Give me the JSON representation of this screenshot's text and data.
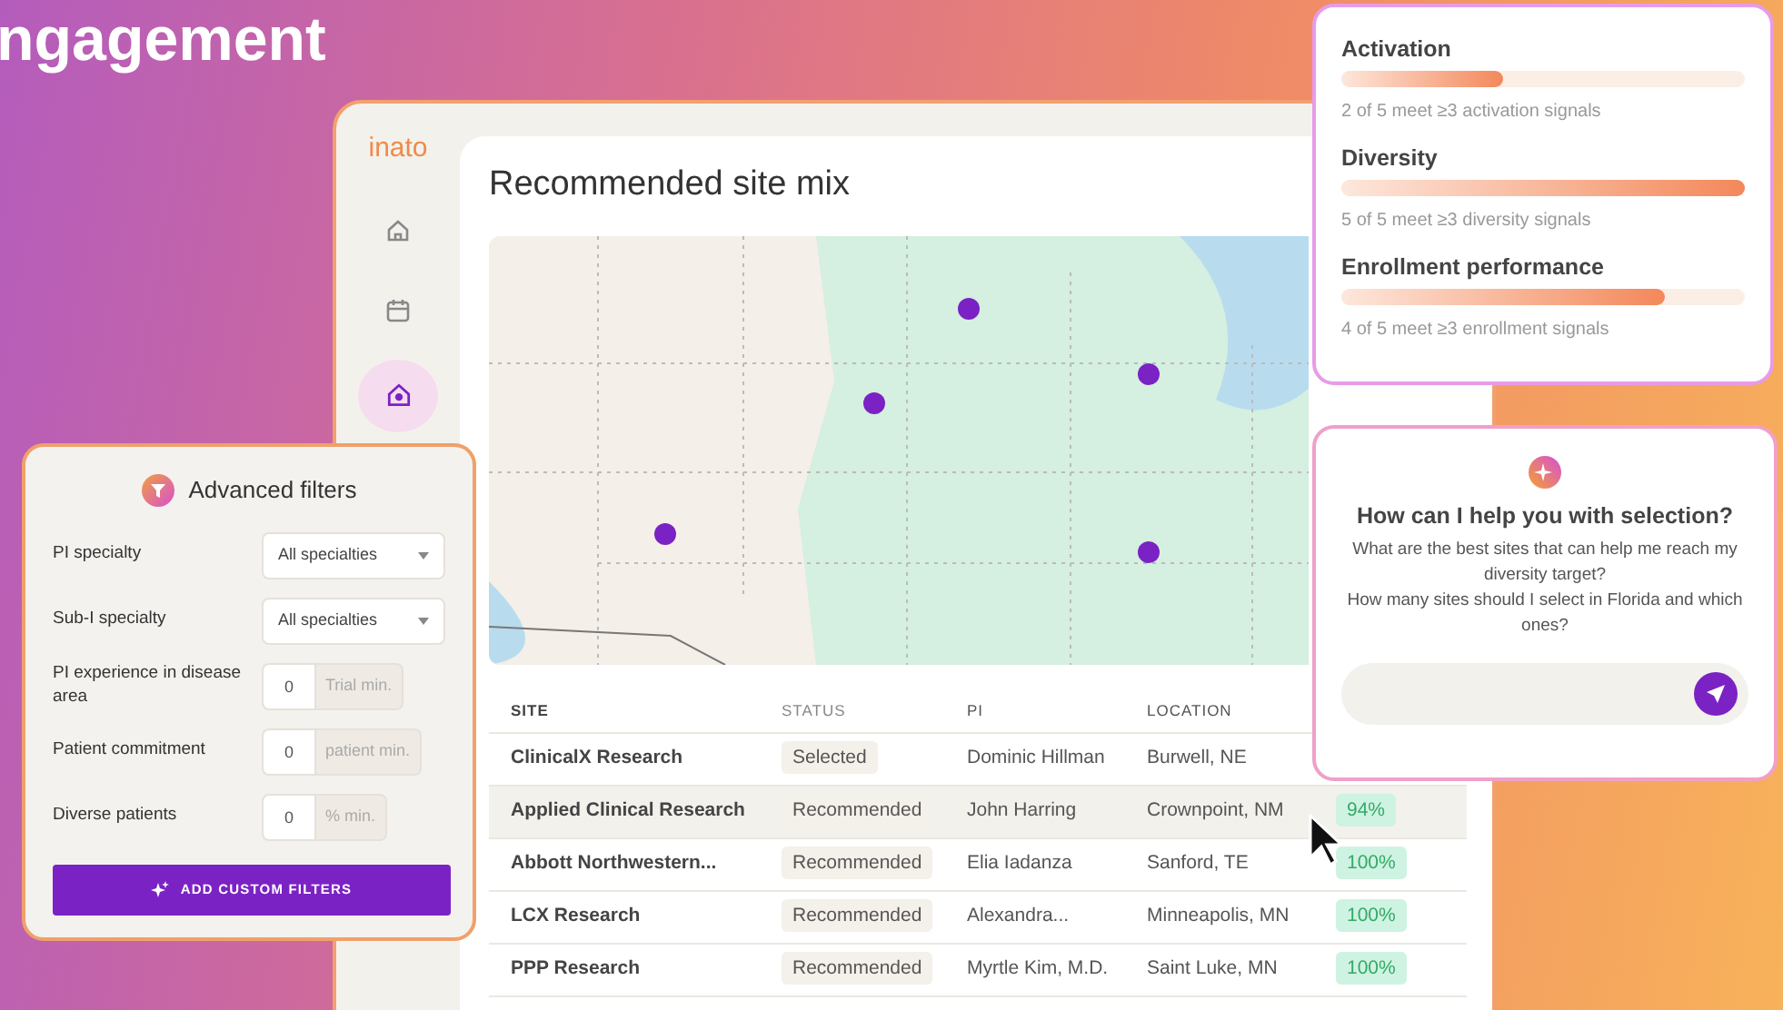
{
  "headline": "ngagement",
  "app": {
    "logo": "inato",
    "sidebar": [
      {
        "kind": "home",
        "selected": false
      },
      {
        "kind": "calendar",
        "selected": false
      },
      {
        "kind": "site",
        "selected": true
      }
    ],
    "title": "Recommended site mix",
    "table": {
      "columns": [
        "SITE",
        "STATUS",
        "PI",
        "LOCATION"
      ],
      "rows": [
        {
          "site": "ClinicalX Research",
          "status": "Selected",
          "pi": "Dominic Hillman",
          "location": "Burwell, NE",
          "selected": false
        },
        {
          "site": "Applied Clinical Research",
          "status": "Recommended",
          "pi": "John Harring",
          "location": "Crownpoint, NM",
          "column_5": "94%",
          "selected": true
        },
        {
          "site": "Abbott Northwestern...",
          "status": "Recommended",
          "pi": "Elia Iadanza",
          "location": "Sanford, TE",
          "column_5": "100%",
          "selected": false
        },
        {
          "site": "LCX Research",
          "status": "Recommended",
          "pi": "Alexandra...",
          "location": "Minneapolis, MN",
          "column_5": "100%",
          "selected": false
        },
        {
          "site": "PPP Research",
          "status": "Recommended",
          "pi": "Myrtle Kim, M.D.",
          "location": "Saint Luke, MN",
          "column_5": "100%",
          "selected": false
        }
      ]
    }
  },
  "filters": {
    "title": "Advanced filters",
    "items": [
      {
        "kind": "select",
        "label": "PI specialty",
        "value": "All specialties"
      },
      {
        "kind": "select",
        "label": "Sub-I specialty",
        "value": "All specialties"
      },
      {
        "kind": "number",
        "label": "PI experience in disease area",
        "value": "0",
        "unit": "Trial min."
      },
      {
        "kind": "number",
        "label": "Patient commitment",
        "value": "0",
        "unit": "patient min."
      },
      {
        "kind": "number",
        "label": "Diverse patients",
        "value": "0",
        "unit": "% min."
      }
    ],
    "button": "ADD CUSTOM FILTERS"
  },
  "signals": [
    {
      "title": "Activation",
      "level": 0.4,
      "caption": "2 of 5 meet ≥3 activation signals"
    },
    {
      "title": "Diversity",
      "level": 1.0,
      "caption": "5 of 5 meet ≥3 diversity signals"
    },
    {
      "title": "Enrollment performance",
      "level": 0.8,
      "caption": "4 of 5 meet ≥3 enrollment signals"
    }
  ],
  "chat": {
    "title": "How can I help you with selection?",
    "suggestions": [
      "What are the best sites that can help me reach my diversity target?",
      "How many sites should I select in Florida and which ones?"
    ]
  }
}
